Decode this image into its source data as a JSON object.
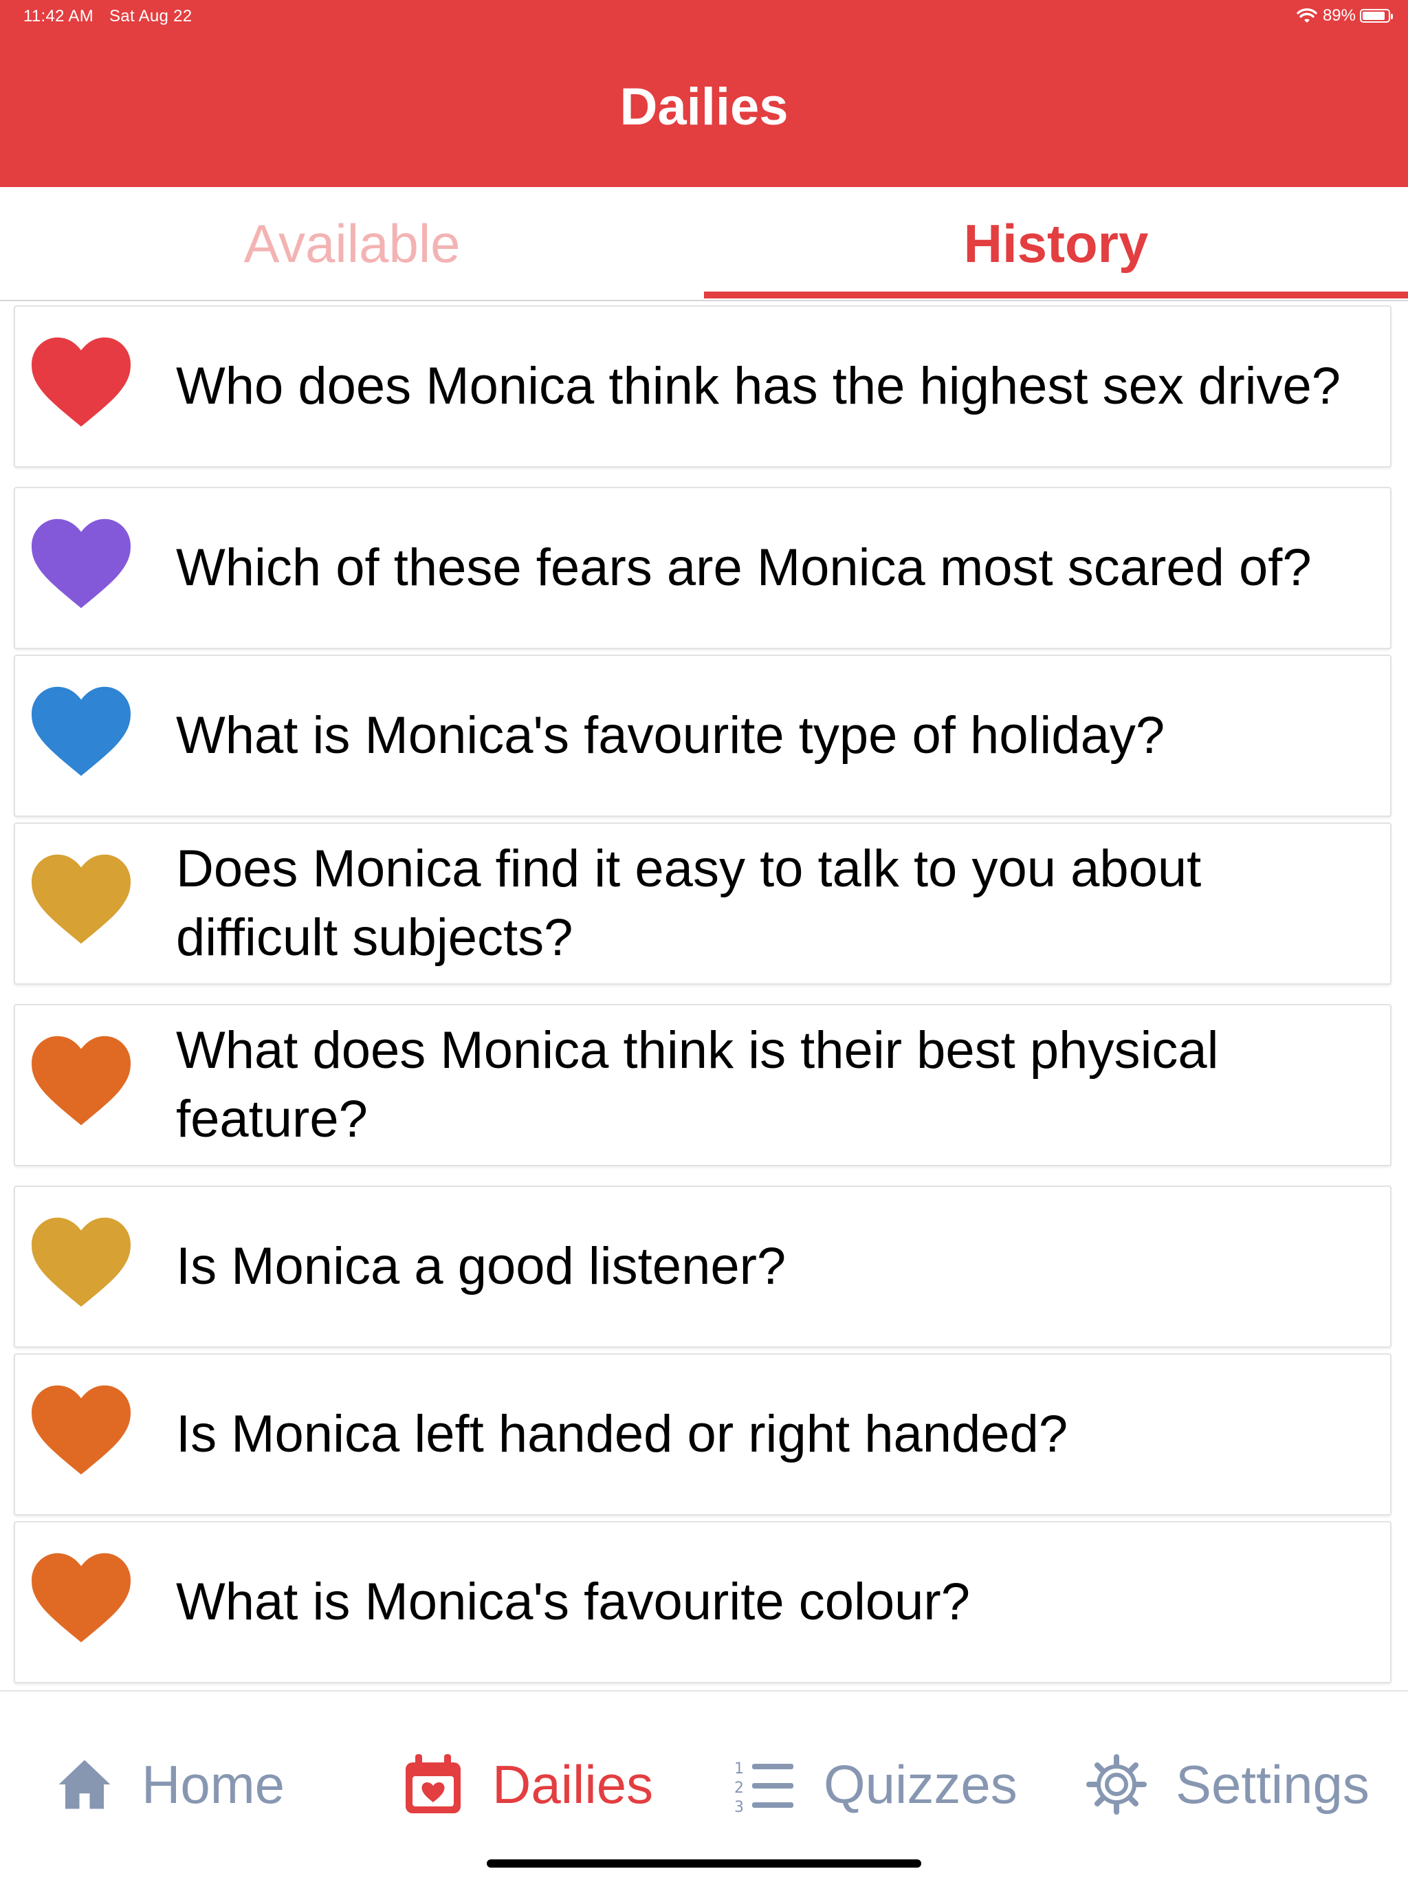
{
  "status_bar": {
    "time": "11:42 AM",
    "date": "Sat Aug 22",
    "battery": "89%",
    "battery_level": 0.89
  },
  "header": {
    "title": "Dailies"
  },
  "tabs": [
    {
      "label": "Available",
      "active": false
    },
    {
      "label": "History",
      "active": true
    }
  ],
  "questions": [
    {
      "text": "Who does Monica think has the highest sex drive?",
      "heart_color": "#e63b43"
    },
    {
      "text": "Which of these fears are Monica most scared of?",
      "heart_color": "#8459d9"
    },
    {
      "text": "What is Monica's favourite type of holiday?",
      "heart_color": "#2f84d3"
    },
    {
      "text": "Does Monica find it easy to talk to you about difficult subjects?",
      "heart_color": "#d7a133"
    },
    {
      "text": "What does Monica think is their best physical feature?",
      "heart_color": "#e06a24"
    },
    {
      "text": "Is Monica a good listener?",
      "heart_color": "#d7a133"
    },
    {
      "text": "Is Monica left handed or right handed?",
      "heart_color": "#e06a24"
    },
    {
      "text": "What is Monica's favourite colour?",
      "heart_color": "#e06a24"
    }
  ],
  "bottom_nav": [
    {
      "label": "Home",
      "icon": "home-icon",
      "active": false
    },
    {
      "label": "Dailies",
      "icon": "calendar-heart-icon",
      "active": true
    },
    {
      "label": "Quizzes",
      "icon": "numbered-list-icon",
      "active": false
    },
    {
      "label": "Settings",
      "icon": "gear-icon",
      "active": false
    }
  ],
  "colors": {
    "accent": "#e33e40",
    "inactive_nav": "#8797b2",
    "inactive_tab": "#f3b3b3"
  }
}
